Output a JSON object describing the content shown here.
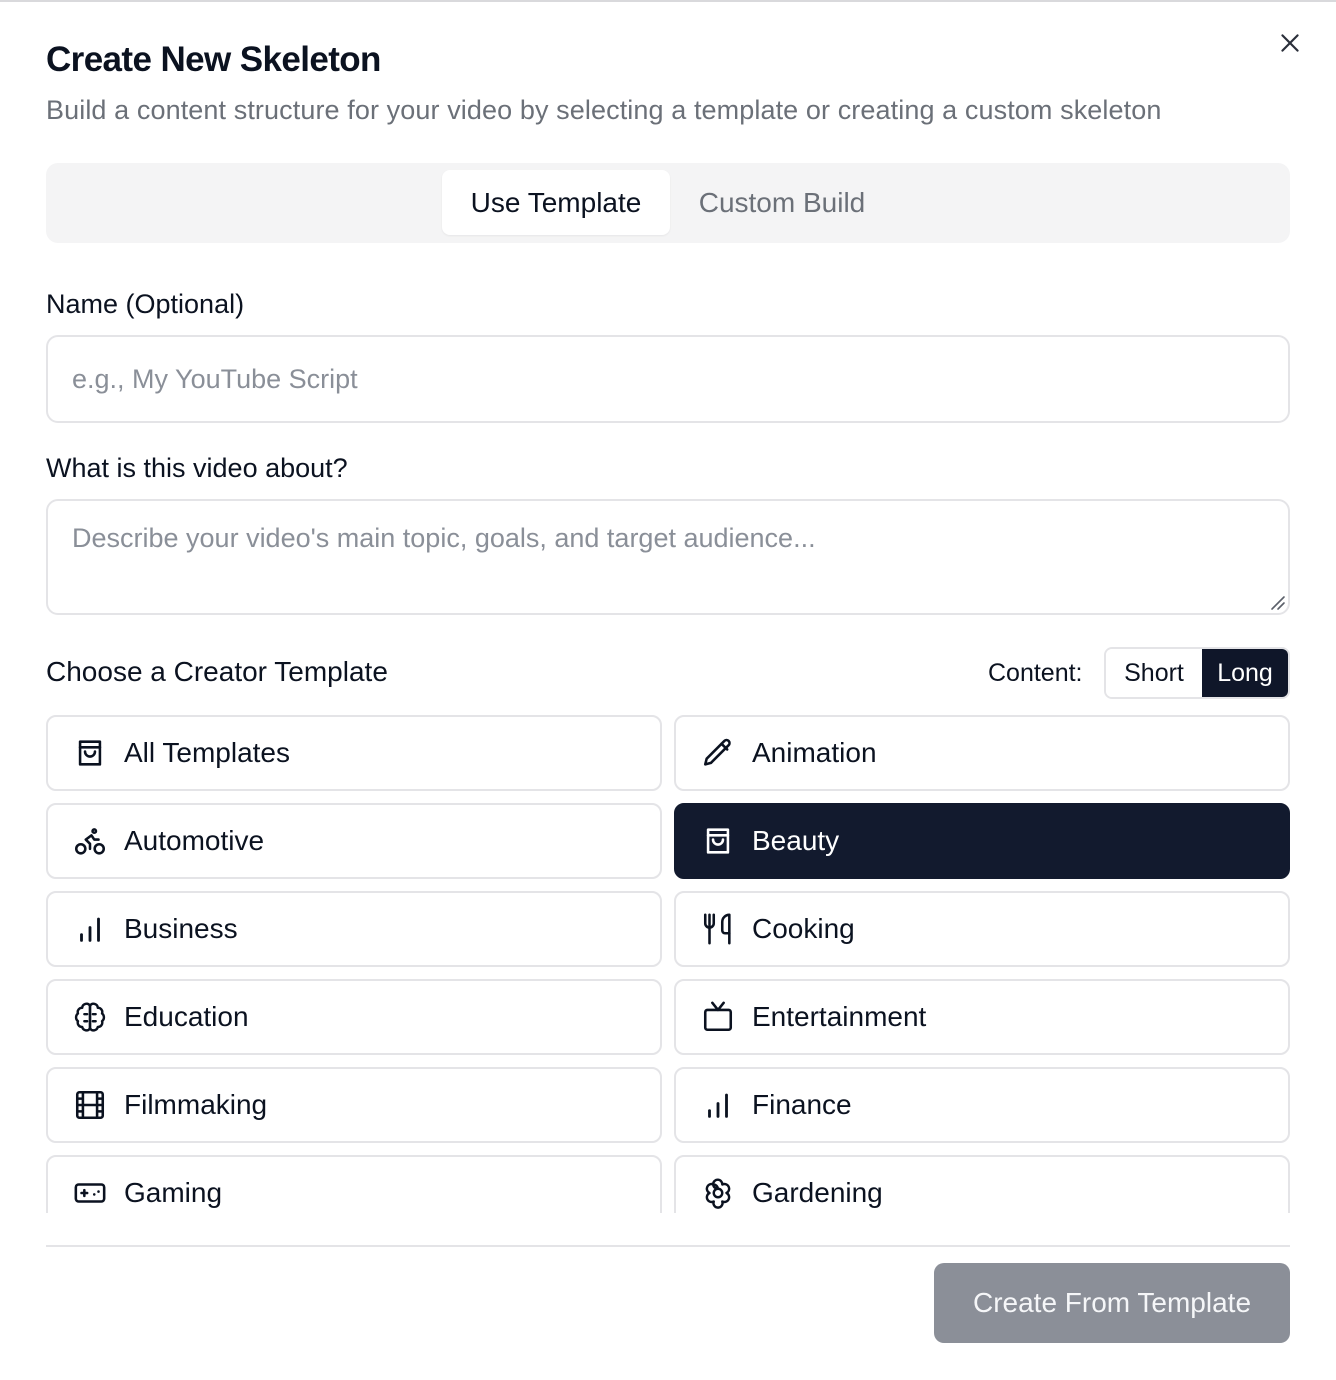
{
  "dialog": {
    "title": "Create New Skeleton",
    "subtitle": "Build a content structure for your video by selecting a template or creating a custom skeleton",
    "close_icon": "close-icon"
  },
  "tabs": [
    {
      "label": "Use Template",
      "active": true
    },
    {
      "label": "Custom Build",
      "active": false
    }
  ],
  "form": {
    "name_label": "Name (Optional)",
    "name_placeholder": "e.g., My YouTube Script",
    "name_value": "",
    "about_label": "What is this video about?",
    "about_placeholder": "Describe your video's main topic, goals, and target audience...",
    "about_value": ""
  },
  "templates_section": {
    "title": "Choose a Creator Template",
    "content_label": "Content:",
    "content_options": [
      "Short",
      "Long"
    ],
    "content_selected": "Long",
    "items": [
      {
        "label": "All Templates",
        "icon": "shopping-bag-icon",
        "selected": false
      },
      {
        "label": "Animation",
        "icon": "pencil-icon",
        "selected": false
      },
      {
        "label": "Automotive",
        "icon": "bike-icon",
        "selected": false
      },
      {
        "label": "Beauty",
        "icon": "shopping-bag-icon",
        "selected": true
      },
      {
        "label": "Business",
        "icon": "bar-chart-icon",
        "selected": false
      },
      {
        "label": "Cooking",
        "icon": "utensils-icon",
        "selected": false
      },
      {
        "label": "Education",
        "icon": "brain-icon",
        "selected": false
      },
      {
        "label": "Entertainment",
        "icon": "tv-icon",
        "selected": false
      },
      {
        "label": "Filmmaking",
        "icon": "film-icon",
        "selected": false
      },
      {
        "label": "Finance",
        "icon": "bar-chart-icon",
        "selected": false
      },
      {
        "label": "Gaming",
        "icon": "gamepad-icon",
        "selected": false
      },
      {
        "label": "Gardening",
        "icon": "flower-icon",
        "selected": false
      }
    ]
  },
  "footer": {
    "cta_label": "Create From Template"
  },
  "colors": {
    "selected_bg": "#121a2e",
    "cta_disabled_bg": "#8b8f98",
    "border": "#e4e4e7",
    "muted_text": "#6b7078"
  }
}
